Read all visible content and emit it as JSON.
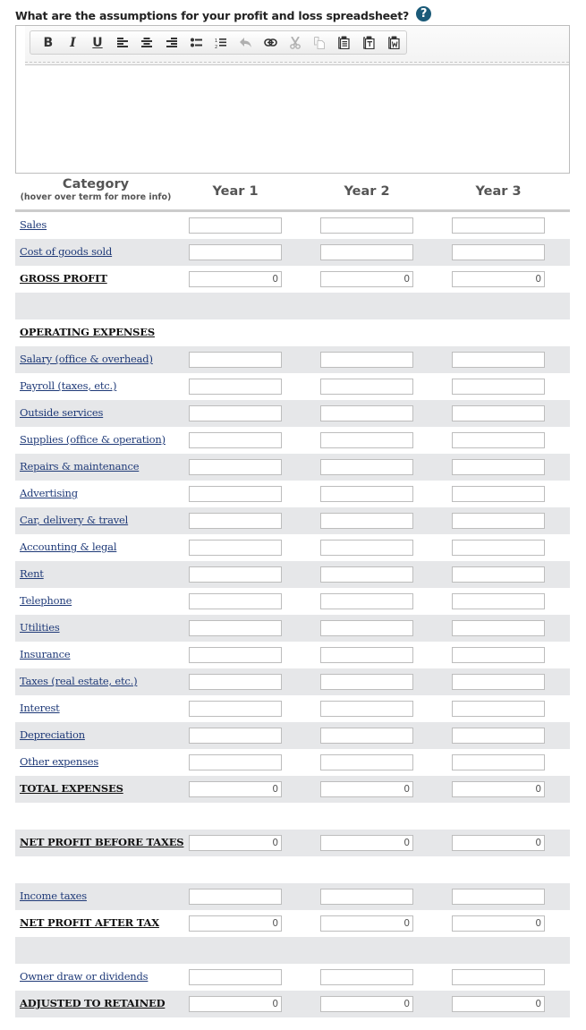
{
  "question": {
    "text": "What are the assumptions for your profit and loss spreadsheet?",
    "help_icon": "question-circle-icon",
    "help_glyph": "?"
  },
  "editor": {
    "toolbar": [
      {
        "name": "bold",
        "icon": "bold-icon",
        "glyph": "B",
        "enabled": true
      },
      {
        "name": "italic",
        "icon": "italic-icon",
        "glyph": "I",
        "enabled": true
      },
      {
        "name": "underline",
        "icon": "underline-icon",
        "glyph": "U",
        "enabled": true
      },
      {
        "name": "align-left",
        "icon": "align-left-icon",
        "enabled": true
      },
      {
        "name": "align-center",
        "icon": "align-center-icon",
        "enabled": true
      },
      {
        "name": "align-right",
        "icon": "align-right-icon",
        "enabled": true
      },
      {
        "name": "bulleted-list",
        "icon": "bulleted-list-icon",
        "enabled": true
      },
      {
        "name": "numbered-list",
        "icon": "numbered-list-icon",
        "enabled": true
      },
      {
        "name": "undo",
        "icon": "undo-icon",
        "enabled": false
      },
      {
        "name": "link",
        "icon": "link-icon",
        "enabled": true
      },
      {
        "name": "cut",
        "icon": "cut-icon",
        "enabled": false
      },
      {
        "name": "copy",
        "icon": "copy-icon",
        "enabled": false
      },
      {
        "name": "paste",
        "icon": "paste-icon",
        "enabled": true
      },
      {
        "name": "paste-as-text",
        "icon": "paste-text-icon",
        "enabled": true
      },
      {
        "name": "paste-from-word",
        "icon": "paste-word-icon",
        "enabled": true
      }
    ],
    "content": ""
  },
  "table": {
    "header": {
      "category": "Category",
      "category_hint": "(hover over term for more info)",
      "years": [
        "Year 1",
        "Year 2",
        "Year 3"
      ]
    },
    "rows": [
      {
        "label": "Sales",
        "type": "input",
        "values": [
          "",
          "",
          ""
        ]
      },
      {
        "label": "Cost of goods sold",
        "type": "input",
        "values": [
          "",
          "",
          ""
        ]
      },
      {
        "label": "GROSS PROFIT",
        "type": "total",
        "values": [
          "0",
          "0",
          "0"
        ]
      },
      {
        "label": "",
        "type": "blank",
        "values": []
      },
      {
        "label": "OPERATING EXPENSES",
        "type": "heading",
        "values": []
      },
      {
        "label": "Salary (office & overhead)",
        "type": "input",
        "values": [
          "",
          "",
          ""
        ]
      },
      {
        "label": "Payroll (taxes, etc.)",
        "type": "input",
        "values": [
          "",
          "",
          ""
        ]
      },
      {
        "label": "Outside services",
        "type": "input",
        "values": [
          "",
          "",
          ""
        ]
      },
      {
        "label": "Supplies (office & operation)",
        "type": "input",
        "values": [
          "",
          "",
          ""
        ]
      },
      {
        "label": "Repairs & maintenance",
        "type": "input",
        "values": [
          "",
          "",
          ""
        ]
      },
      {
        "label": "Advertising",
        "type": "input",
        "values": [
          "",
          "",
          ""
        ]
      },
      {
        "label": "Car, delivery & travel",
        "type": "input",
        "values": [
          "",
          "",
          ""
        ]
      },
      {
        "label": "Accounting & legal",
        "type": "input",
        "values": [
          "",
          "",
          ""
        ]
      },
      {
        "label": "Rent",
        "type": "input",
        "values": [
          "",
          "",
          ""
        ]
      },
      {
        "label": "Telephone",
        "type": "input",
        "values": [
          "",
          "",
          ""
        ]
      },
      {
        "label": "Utilities",
        "type": "input",
        "values": [
          "",
          "",
          ""
        ]
      },
      {
        "label": "Insurance",
        "type": "input",
        "values": [
          "",
          "",
          ""
        ]
      },
      {
        "label": "Taxes (real estate, etc.)",
        "type": "input",
        "values": [
          "",
          "",
          ""
        ]
      },
      {
        "label": "Interest",
        "type": "input",
        "values": [
          "",
          "",
          ""
        ]
      },
      {
        "label": "Depreciation",
        "type": "input",
        "values": [
          "",
          "",
          ""
        ]
      },
      {
        "label": "Other expenses",
        "type": "input",
        "values": [
          "",
          "",
          ""
        ]
      },
      {
        "label": "TOTAL EXPENSES",
        "type": "total",
        "values": [
          "0",
          "0",
          "0"
        ]
      },
      {
        "label": "",
        "type": "blank",
        "values": []
      },
      {
        "label": "NET PROFIT BEFORE TAXES",
        "type": "total",
        "values": [
          "0",
          "0",
          "0"
        ]
      },
      {
        "label": "",
        "type": "blank",
        "values": []
      },
      {
        "label": "Income taxes",
        "type": "input",
        "values": [
          "",
          "",
          ""
        ]
      },
      {
        "label": "NET PROFIT AFTER TAX",
        "type": "total",
        "values": [
          "0",
          "0",
          "0"
        ]
      },
      {
        "label": "",
        "type": "blank",
        "values": []
      },
      {
        "label": "Owner draw or dividends",
        "type": "input",
        "values": [
          "",
          "",
          ""
        ]
      },
      {
        "label": "ADJUSTED TO RETAINED",
        "type": "total",
        "values": [
          "0",
          "0",
          "0"
        ]
      }
    ]
  },
  "colors": {
    "link": "#1f3a78",
    "bold_label": "#111111",
    "stripe": "#e6e7e9",
    "help_icon": "#1a5a78",
    "header_text": "#555555"
  }
}
